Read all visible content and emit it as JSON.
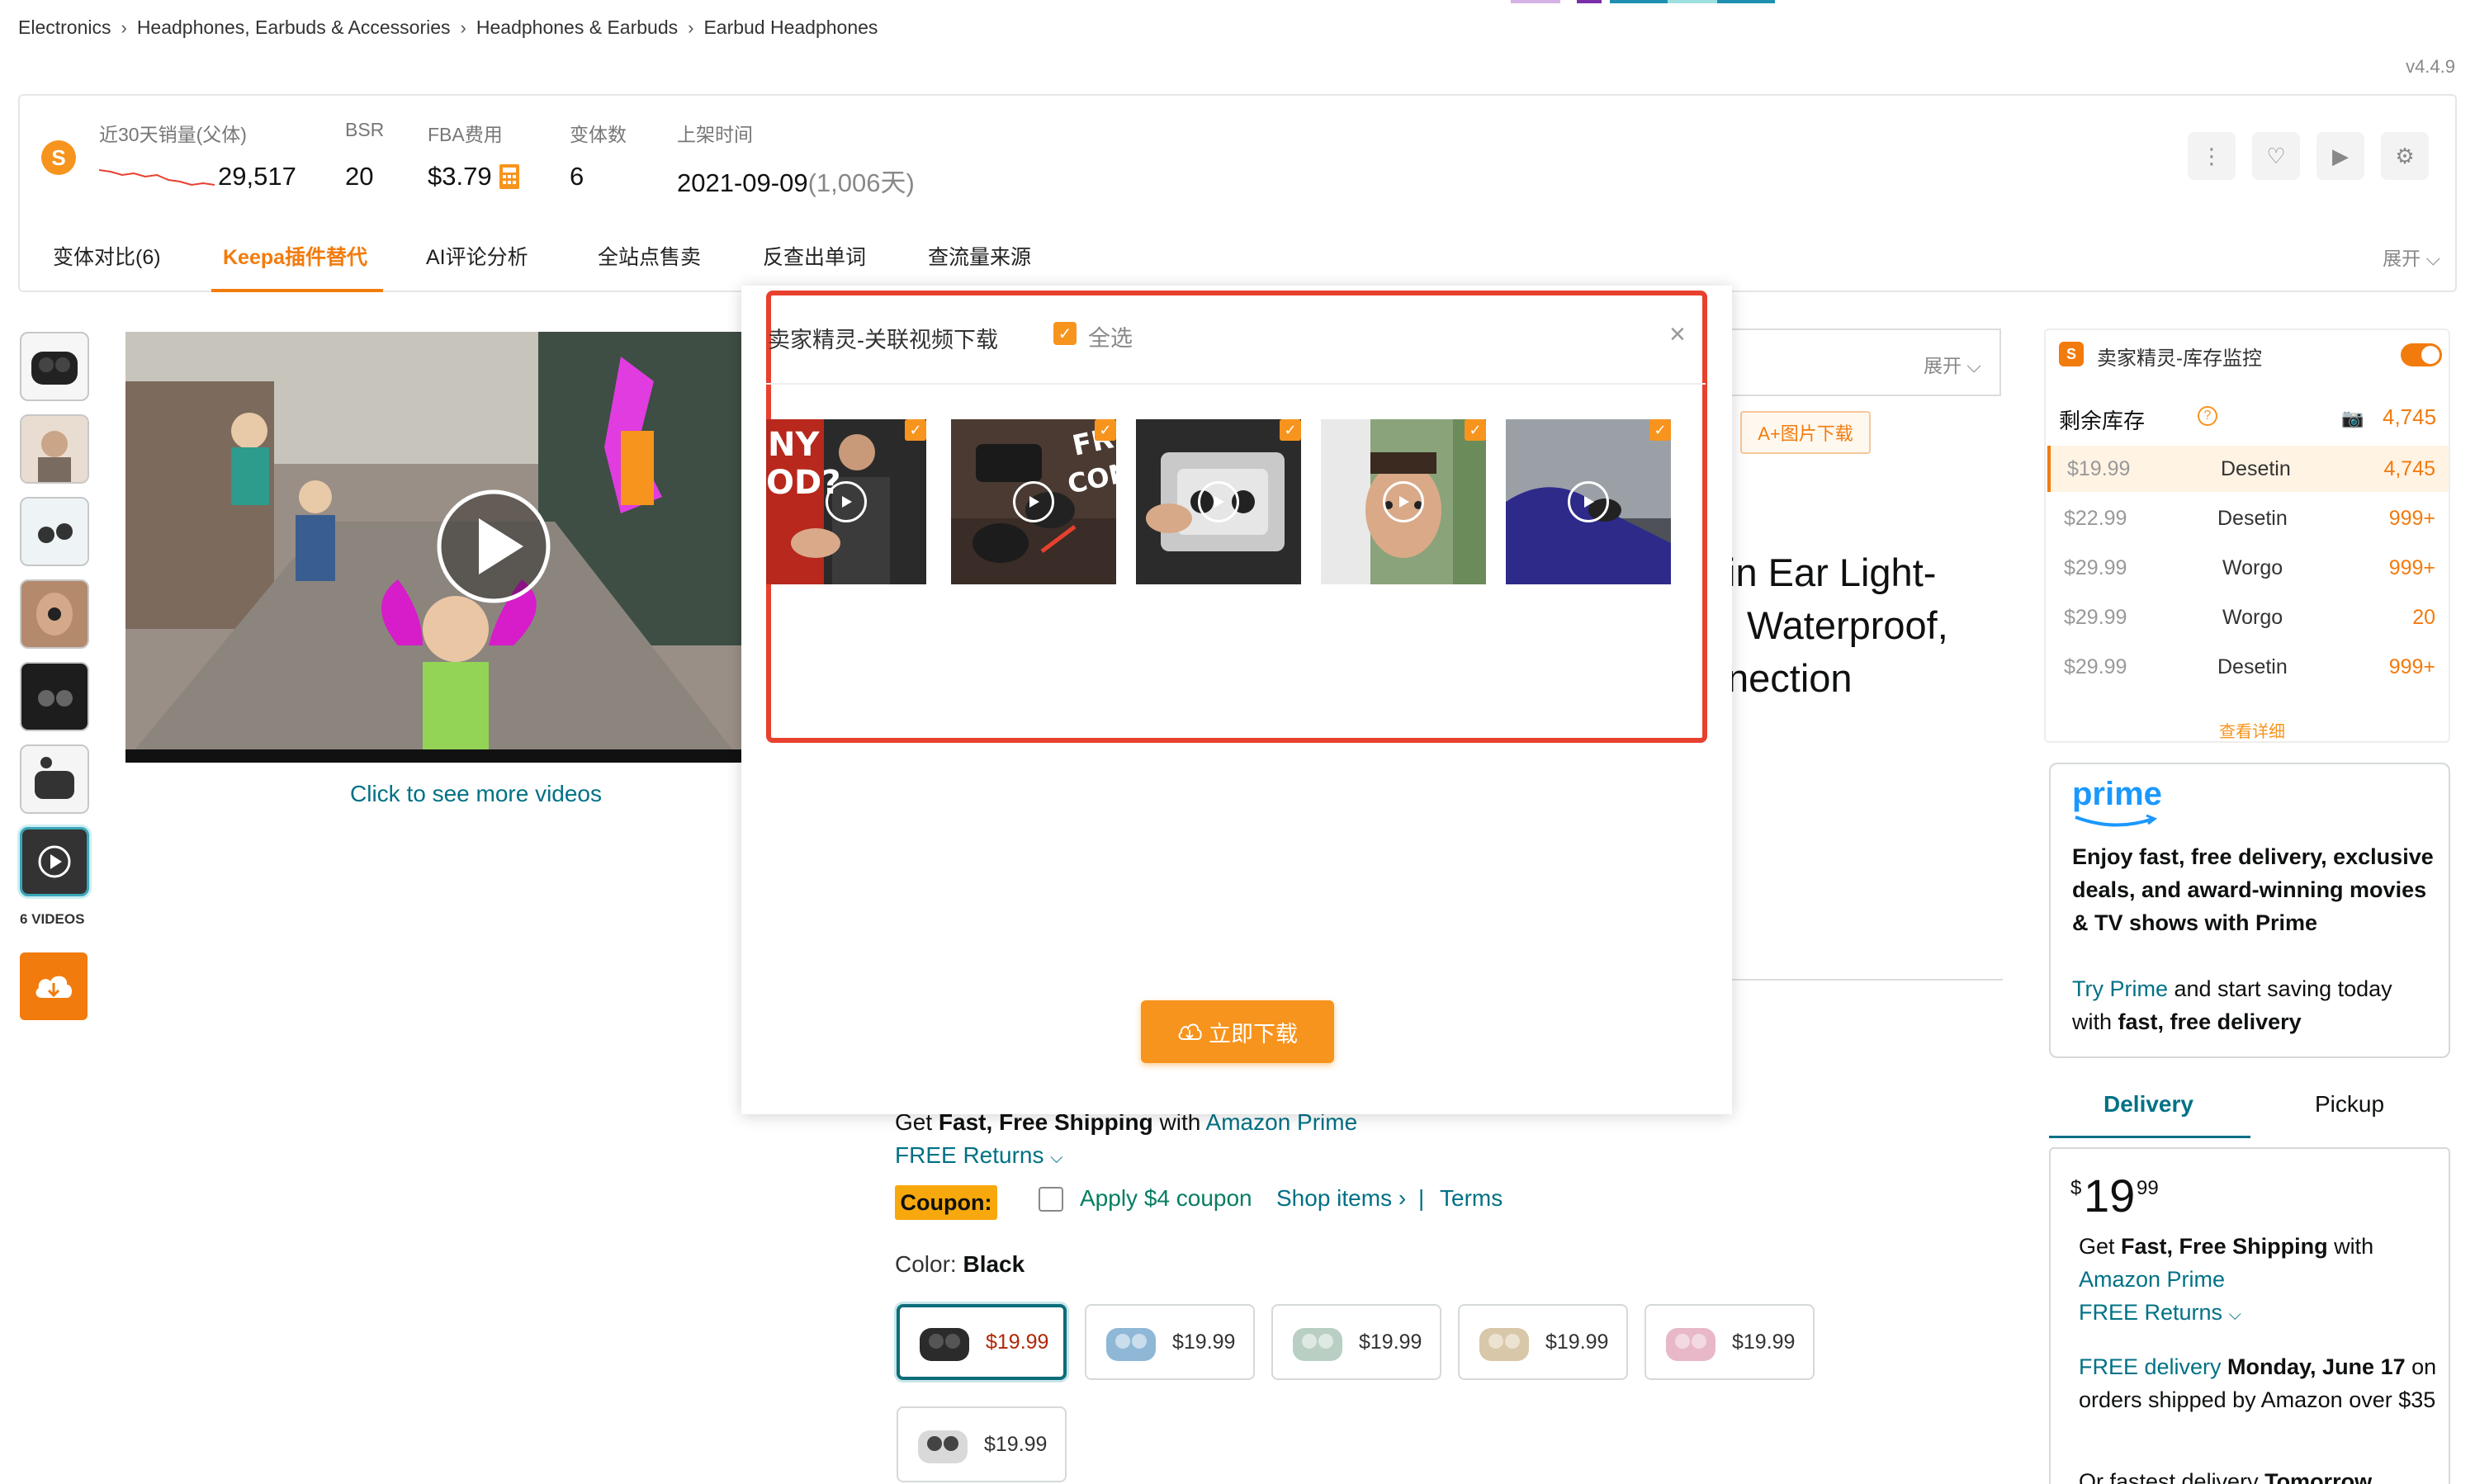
{
  "top_strip_colors": [
    "#d5b2e6",
    "#7a2ea8",
    "#1f8fb0",
    "#9ee0e0",
    "#1f8fb0"
  ],
  "breadcrumb": [
    "Electronics",
    "Headphones, Earbuds & Accessories",
    "Headphones & Earbuds",
    "Earbud Headphones"
  ],
  "breadcrumb_sep": "›",
  "version": "v4.4.9",
  "plugin": {
    "logo_glyph": "S",
    "stats": [
      {
        "label": "近30天销量(父体)",
        "value": "29,517"
      },
      {
        "label": "BSR",
        "value": "20"
      },
      {
        "label": "FBA费用",
        "value": "$3.79"
      },
      {
        "label": "变体数",
        "value": "6"
      },
      {
        "label": "上架时间",
        "value": "2021-09-09",
        "extra": "(1,006天)"
      }
    ],
    "tools": [
      "more-vertical-icon",
      "heart-icon",
      "play-box-icon",
      "settings-icon"
    ],
    "tool_glyphs": [
      "⋮",
      "♡",
      "▶",
      "⚙"
    ],
    "tabs": [
      "变体对比(6)",
      "Keepa插件替代",
      "AI评论分析",
      "全站点售卖",
      "反查出单词",
      "查流量来源"
    ],
    "active_tab": 1,
    "expand_label": "展开"
  },
  "gallery": {
    "videos_label": "6 VIDEOS",
    "more_videos": "Click to see more videos"
  },
  "modal": {
    "title": "卖家精灵-关联视频下载",
    "select_all": "全选",
    "close_glyph": "×",
    "check_glyph": "✓",
    "download_label": "立即下载",
    "thumb_count": 5
  },
  "background": {
    "expand_label": "展开",
    "aplus_label": "A+图片下载",
    "title_lines": [
      "in Ear Light-",
      "Waterproof,",
      "nection"
    ],
    "shipping": {
      "pre": "Get ",
      "bold": "Fast, Free Shipping",
      "mid": " with ",
      "link": "Amazon Prime"
    },
    "free_returns": "FREE Returns",
    "coupon_badge": "Coupon:",
    "coupon_apply": "Apply $4 coupon",
    "coupon_shop": "Shop items ›",
    "coupon_sep": "|",
    "coupon_terms": "Terms",
    "color_label": "Color:",
    "color_value": "Black",
    "swatches": [
      {
        "price": "$19.99",
        "color": "#2b2b2b",
        "selected": true
      },
      {
        "price": "$19.99",
        "color": "#8fb7d6",
        "selected": false
      },
      {
        "price": "$19.99",
        "color": "#b9cfc3",
        "selected": false
      },
      {
        "price": "$19.99",
        "color": "#d8c7a8",
        "selected": false
      },
      {
        "price": "$19.99",
        "color": "#e8b8c8",
        "selected": false
      },
      {
        "price": "$19.99",
        "color": "#d9d9d9",
        "selected": false
      }
    ]
  },
  "inventory": {
    "title": "卖家精灵-库存监控",
    "head_label": "剩余库存",
    "head_value": "4,745",
    "rows": [
      {
        "price": "$19.99",
        "seller": "Desetin",
        "qty": "4,745"
      },
      {
        "price": "$22.99",
        "seller": "Desetin",
        "qty": "999+"
      },
      {
        "price": "$29.99",
        "seller": "Worgo",
        "qty": "999+"
      },
      {
        "price": "$29.99",
        "seller": "Worgo",
        "qty": "20"
      },
      {
        "price": "$29.99",
        "seller": "Desetin",
        "qty": "999+"
      }
    ],
    "more_label": "查看详细"
  },
  "prime": {
    "logo": "prime",
    "text": "Enjoy fast, free delivery, exclusive deals, and award-winning movies & TV shows with Prime",
    "try_link": "Try Prime",
    "try_rest": " and start saving today with ",
    "try_bold": "fast, free delivery"
  },
  "delivery_tabs": [
    "Delivery",
    "Pickup"
  ],
  "buy_box": {
    "price_symbol": "$",
    "price_whole": "19",
    "price_fraction": "99",
    "ship_pre": "Get ",
    "ship_bold": "Fast, Free Shipping",
    "ship_mid": " with ",
    "ship_link": "Amazon Prime",
    "free_returns": "FREE Returns",
    "delivery_link": "FREE delivery",
    "delivery_bold": " Monday, June 17",
    "delivery_rest": " on orders shipped by Amazon over $35",
    "fastest": "Or fastest delivery ",
    "fastest_bold": "Tomorrow"
  }
}
